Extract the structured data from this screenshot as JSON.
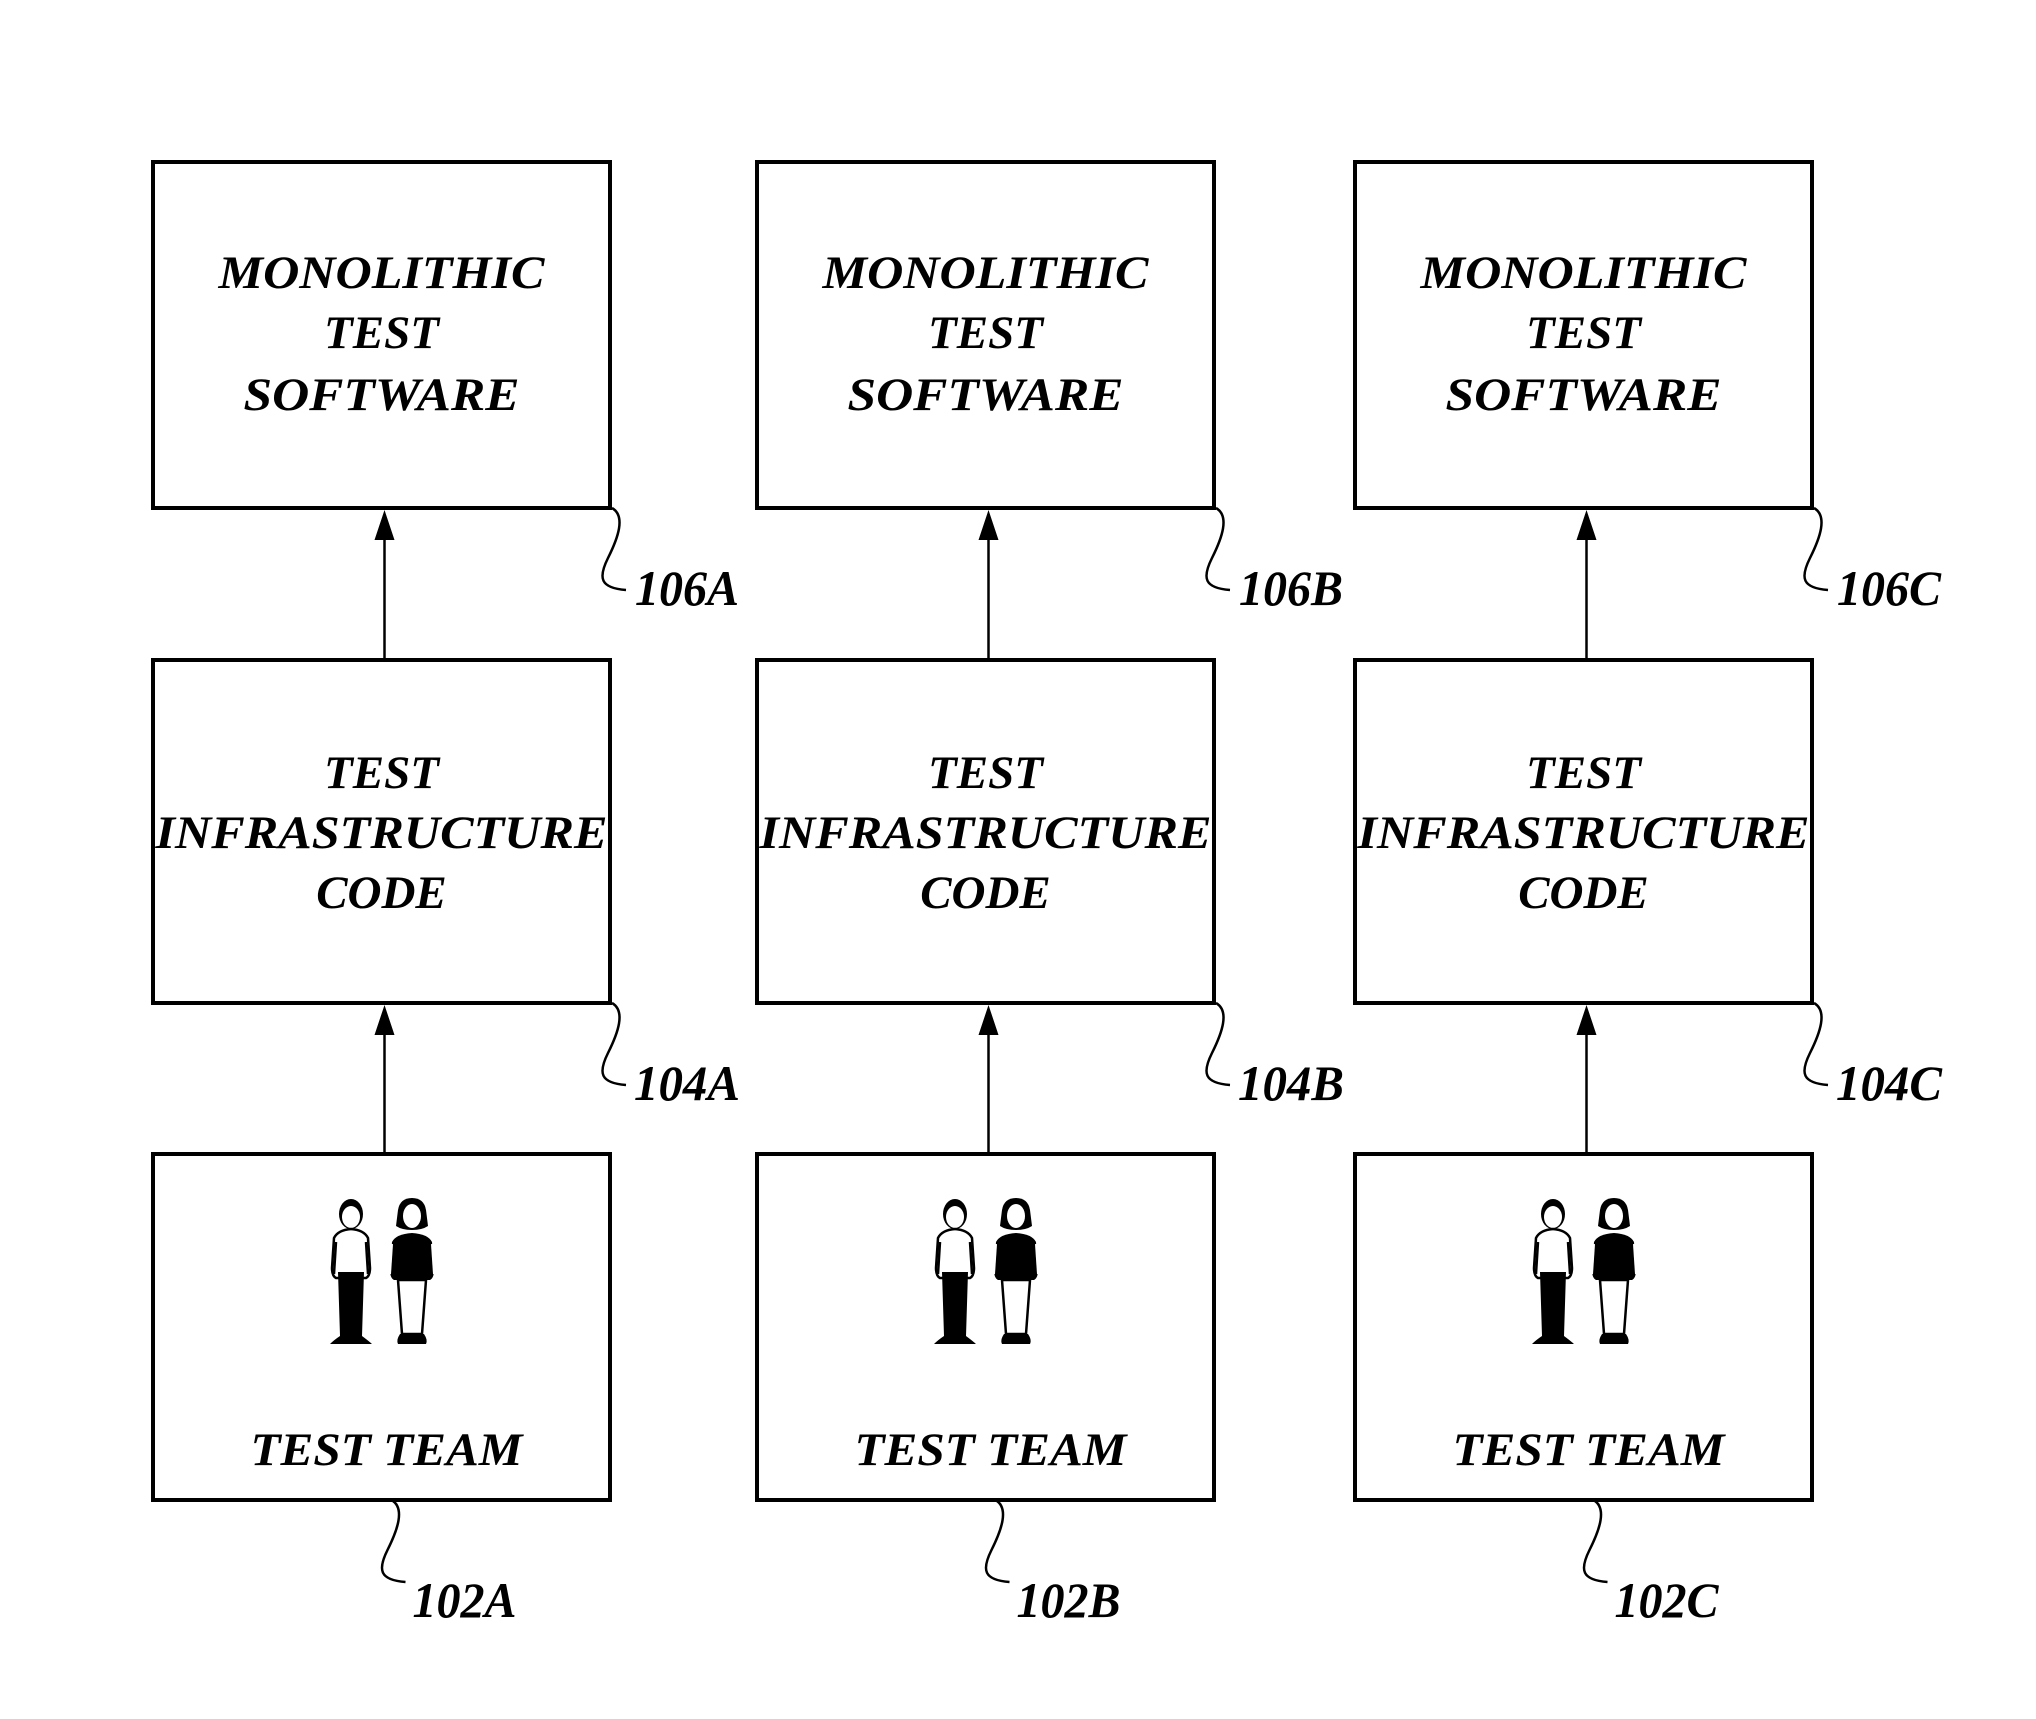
{
  "figure": {
    "columns": [
      {
        "id": "A",
        "software": {
          "lines": [
            "MONOLITHIC",
            "TEST",
            "SOFTWARE"
          ],
          "ref": "106A"
        },
        "infrastructure": {
          "lines": [
            "TEST",
            "INFRASTRUCTURE",
            "CODE"
          ],
          "ref": "104A"
        },
        "team": {
          "label": "TEST TEAM",
          "icon": "people-icon",
          "ref": "102A"
        }
      },
      {
        "id": "B",
        "software": {
          "lines": [
            "MONOLITHIC",
            "TEST",
            "SOFTWARE"
          ],
          "ref": "106B"
        },
        "infrastructure": {
          "lines": [
            "TEST",
            "INFRASTRUCTURE",
            "CODE"
          ],
          "ref": "104B"
        },
        "team": {
          "label": "TEST TEAM",
          "icon": "people-icon",
          "ref": "102B"
        }
      },
      {
        "id": "C",
        "software": {
          "lines": [
            "MONOLITHIC",
            "TEST",
            "SOFTWARE"
          ],
          "ref": "106C"
        },
        "infrastructure": {
          "lines": [
            "TEST",
            "INFRASTRUCTURE",
            "CODE"
          ],
          "ref": "104C"
        },
        "team": {
          "label": "TEST TEAM",
          "icon": "people-icon",
          "ref": "102C"
        }
      }
    ],
    "arrows": [
      "team-to-infrastructure",
      "infrastructure-to-software"
    ]
  }
}
